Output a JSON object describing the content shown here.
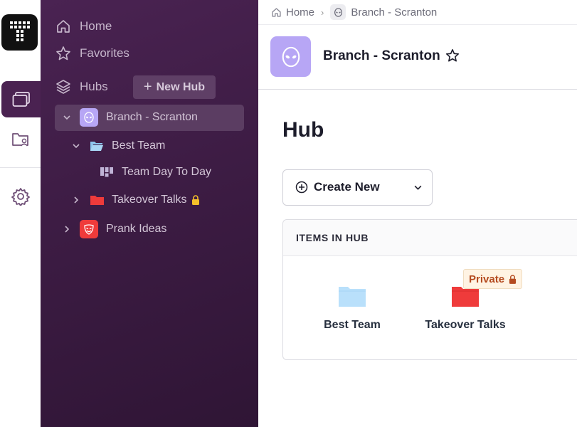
{
  "rail": {
    "items": [
      "logo",
      "hubs",
      "folders",
      "settings"
    ]
  },
  "sidebar": {
    "nav": {
      "home": "Home",
      "favorites": "Favorites",
      "hubs": "Hubs"
    },
    "new_hub": "New Hub",
    "tree": [
      {
        "label": "Branch - Scranton",
        "level": 0,
        "expanded": true,
        "selected": true,
        "icon": "alien-icon",
        "color": "#b7a6f5"
      },
      {
        "label": "Best Team",
        "level": 1,
        "expanded": true,
        "icon": "folder-open-icon",
        "color": "#a9d6f5"
      },
      {
        "label": "Team Day To Day",
        "level": 2,
        "icon": "board-icon",
        "color": "#bfb3d6"
      },
      {
        "label": "Takeover Talks",
        "level": 1,
        "expanded": false,
        "locked": true,
        "icon": "folder-icon",
        "color": "#ef3b3b"
      },
      {
        "label": "Prank Ideas",
        "level": 0,
        "expanded": false,
        "icon": "mask-icon",
        "color": "#ef3b3b"
      }
    ]
  },
  "breadcrumb": {
    "home": "Home",
    "current": "Branch - Scranton"
  },
  "header": {
    "title": "Branch - Scranton"
  },
  "page": {
    "title": "Hub"
  },
  "create": {
    "label": "Create New"
  },
  "panel": {
    "heading": "ITEMS IN HUB",
    "items": [
      {
        "label": "Best Team",
        "icon": "folder-icon",
        "color": "#b9e0fb"
      },
      {
        "label": "Takeover Talks",
        "icon": "folder-icon",
        "color": "#ef3b3b",
        "badge": "Private"
      }
    ]
  },
  "colors": {
    "sidebar_bg": "#3d1c44",
    "accent": "#b7a6f5",
    "danger": "#ef3b3b"
  }
}
